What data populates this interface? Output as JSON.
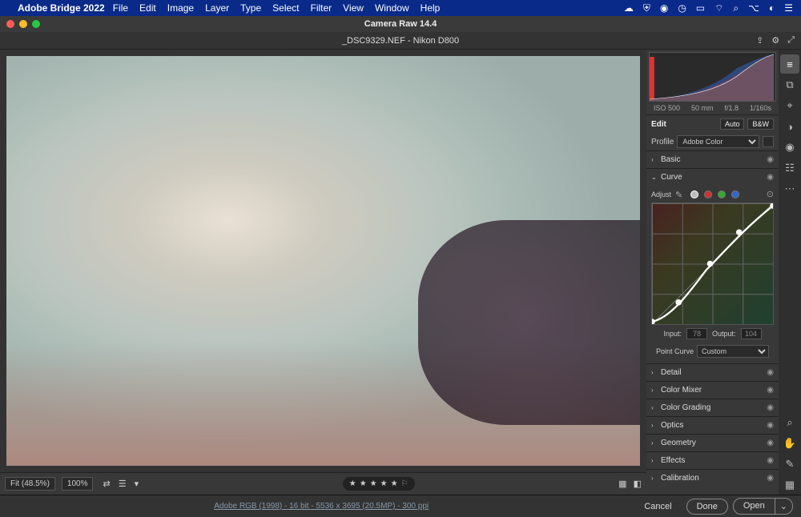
{
  "menubar": {
    "app_name": "Adobe Bridge 2022",
    "items": [
      "File",
      "Edit",
      "Image",
      "Layer",
      "Type",
      "Select",
      "Filter",
      "View",
      "Window",
      "Help"
    ],
    "tray_icons": [
      "cloud-icon",
      "shield-icon",
      "creative-cloud-icon",
      "clock-icon",
      "battery-icon",
      "wifi-icon",
      "search-icon",
      "control-center-icon",
      "siri-icon",
      "notifications-icon"
    ]
  },
  "window": {
    "title": "Camera Raw 14.4",
    "filename": "_DSC9329.NEF  -  Nikon D800"
  },
  "viewer": {
    "fit_label": "Fit (48.5%)",
    "zoom_label": "100%",
    "rating_stars": 5
  },
  "exif": {
    "iso": "ISO 500",
    "focal": "50 mm",
    "aperture": "f/1.8",
    "shutter": "1/160s"
  },
  "edit_panel": {
    "title": "Edit",
    "auto": "Auto",
    "bw": "B&W",
    "profile_label": "Profile",
    "profile_value": "Adobe Color"
  },
  "sections": {
    "basic": "Basic",
    "curve": "Curve",
    "detail": "Detail",
    "color_mixer": "Color Mixer",
    "color_grading": "Color Grading",
    "optics": "Optics",
    "geometry": "Geometry",
    "effects": "Effects",
    "calibration": "Calibration"
  },
  "curve": {
    "adjust_label": "Adjust",
    "input_label": "Input:",
    "output_label": "Output:",
    "input_value": "78",
    "output_value": "104",
    "point_curve_label": "Point Curve",
    "point_curve_value": "Custom"
  },
  "footer": {
    "meta": "Adobe RGB (1998) - 16 bit - 5536 x 3695 (20.5MP) - 300 ppi",
    "cancel": "Cancel",
    "done": "Done",
    "open": "Open"
  },
  "toolstrip": [
    "edit-sliders-icon",
    "crop-icon",
    "spot-heal-icon",
    "masking-icon",
    "redeye-icon",
    "presets-icon",
    "snapshots-icon",
    "zoom-icon",
    "hand-icon",
    "color-sampler-icon",
    "grid-icon"
  ]
}
